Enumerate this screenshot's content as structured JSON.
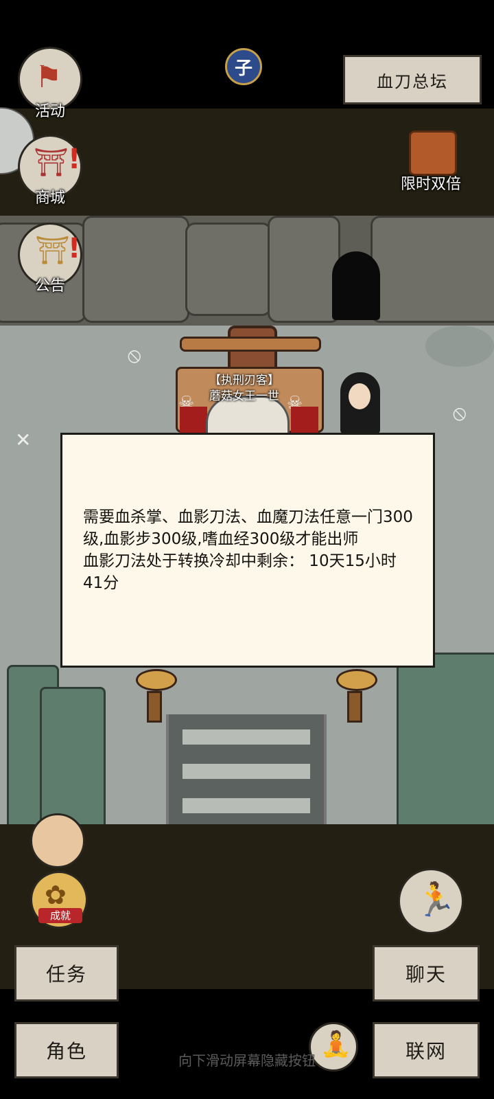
{
  "top_left_buttons": [
    {
      "label": "活动"
    },
    {
      "label": "商城"
    },
    {
      "label": "公告"
    }
  ],
  "clock_glyph": "子",
  "location_button": "血刀总坛",
  "promo": {
    "label": "限时双倍"
  },
  "npc": {
    "title": "【执刑刃客】",
    "name": "蘑菇女王一世"
  },
  "dialog": {
    "lines": [
      "需要血杀掌、血影刀法、血魔刀法任意一门300级,血影步300级,嗜血经300级才能出师",
      "血影刀法处于转换冷却中剩余：  10天15小时41分"
    ]
  },
  "achievement_label": "成就",
  "bottom_buttons": {
    "tasks": "任务",
    "character": "角色",
    "chat": "聊天",
    "network": "联网"
  },
  "hint": "向下滑动屏幕隐藏按钮",
  "colors": {
    "band": "#231f12",
    "dialog_bg": "#fdf8ea",
    "button_bg": "#d8d1c4",
    "alert": "#d42a1f"
  }
}
